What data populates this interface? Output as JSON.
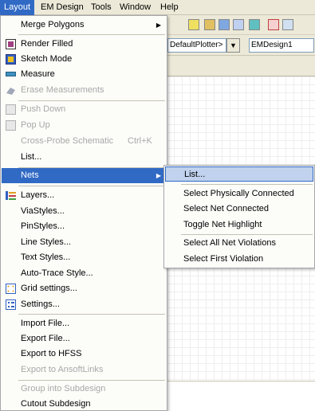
{
  "menubar": {
    "items": [
      {
        "label": "Layout",
        "active": true
      },
      {
        "label": "EM Design",
        "active": false
      },
      {
        "label": "Tools",
        "active": false
      },
      {
        "label": "Window",
        "active": false
      },
      {
        "label": "Help",
        "active": false
      }
    ]
  },
  "toolbar": {
    "plotter_combo": "DefaultPlotter>",
    "design_combo": "EMDesign1"
  },
  "layout_menu": {
    "merge_polygons": "Merge Polygons",
    "render_filled": "Render Filled",
    "sketch_mode": "Sketch Mode",
    "measure": "Measure",
    "erase_measurements": "Erase Measurements",
    "push_down": "Push Down",
    "pop_up": "Pop Up",
    "cross_probe": "Cross-Probe Schematic",
    "cross_probe_shortcut": "Ctrl+K",
    "list": "List...",
    "nets": "Nets",
    "layers": "Layers...",
    "via_styles": "ViaStyles...",
    "pin_styles": "PinStyles...",
    "line_styles": "Line Styles...",
    "text_styles": "Text Styles...",
    "auto_trace_style": "Auto-Trace Style...",
    "grid_settings": "Grid settings...",
    "settings": "Settings...",
    "import_file": "Import File...",
    "export_file": "Export File...",
    "export_hfss": "Export to HFSS",
    "export_ansoftlinks": "Export to AnsoftLinks",
    "group_into_subdesign": "Group into Subdesign",
    "cutout_subdesign": "Cutout Subdesign"
  },
  "nets_submenu": {
    "list": "List...",
    "select_physically_connected": "Select Physically Connected",
    "select_net_connected": "Select Net Connected",
    "toggle_net_highlight": "Toggle Net Highlight",
    "select_all_net_violations": "Select All Net Violations",
    "select_first_violation": "Select First Violation"
  },
  "colors": {
    "menu_highlight": "#316ac5",
    "submenu_highlight": "#c1d2ee",
    "menu_background": "#fcfcf9",
    "disabled_text": "#a8a8a8"
  }
}
